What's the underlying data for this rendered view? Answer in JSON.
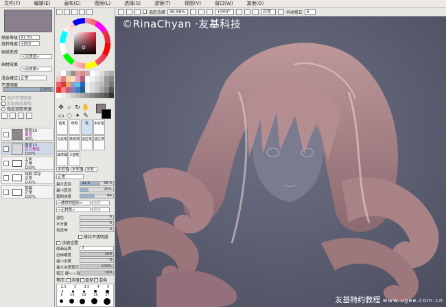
{
  "menu": [
    "文件(F)",
    "编辑(E)",
    "画布(C)",
    "图层(L)",
    "选择(S)",
    "滤镜(T)",
    "视图(V)",
    "窗口(W)",
    "其他(O)"
  ],
  "toolbar": {
    "selection_label": "选区边缘",
    "zoom": "90.96%",
    "angle": "+000°",
    "mode": "正常",
    "stabilizer_label": "抖动修正",
    "stabilizer_value": "6"
  },
  "left": {
    "zoom_label": "缩放等级",
    "zoom_value": "91.3%",
    "angle_label": "旋转角度",
    "angle_value": "+000",
    "paper_texture": "画纸质感",
    "paper_texture_value": "<无质感>",
    "paper_effect": "画材效果",
    "paper_effect_value": "<无效果>",
    "blend_mode_label": "混合模式",
    "blend_mode_value": "正常",
    "opacity_label": "不透明度",
    "opacity_value": "100%",
    "protect_opacity": "保护不透明度",
    "clip_group": "剪贴图层蒙版",
    "source_label": "指定选取来源",
    "layers": [
      {
        "name": "图层10",
        "mode": "覆盖",
        "opacity": "36%",
        "type": "layer",
        "color": "#8a8a8a"
      },
      {
        "name": "图层13",
        "mode": "正片叠底",
        "opacity": "100%",
        "type": "layer",
        "color": "#d8d8d8"
      },
      {
        "name": "上色",
        "mode": "正常",
        "opacity": "100%",
        "type": "folder"
      },
      {
        "name": "线稿 保存",
        "mode": "正常",
        "opacity": "100%",
        "type": "folder"
      },
      {
        "name": "草稿",
        "mode": "正常",
        "opacity": "100%",
        "type": "folder"
      }
    ]
  },
  "brushes": {
    "row1": [
      "铅笔",
      "喷枪",
      "笔",
      "水彩笔"
    ],
    "row2": [
      "马克笔",
      "橡皮擦",
      "选区笔",
      "选区擦"
    ],
    "row3": [
      "油漆桶",
      "2值笔"
    ],
    "row4": [
      "水彩笔",
      "水彩笔",
      "水彩"
    ]
  },
  "settings": {
    "mode": "正常",
    "max_diameter_label": "最大直径",
    "max_diameter_mult": "x1.0",
    "max_diameter_value": "38.0",
    "min_diameter_label": "最小直径",
    "min_diameter_value": "26%",
    "density_label": "笔刷浓度",
    "density_value": "44",
    "shape_value": "<通常的圆形>",
    "shape_strength": "强度",
    "texture_value": "<无材质>",
    "texture_strength": "强度",
    "blend_label": "混色",
    "blend_value": "0",
    "water_label": "水分量",
    "water_value": "0",
    "color_extend_label": "色延伸",
    "color_extend_value": "0",
    "keep_opacity": "维持不透明度",
    "detail_label": "详细设置",
    "quality_label": "绘画品质",
    "quality_value": "3",
    "edge_label": "边缘硬度",
    "edge_value": "100",
    "min_density_label": "最小浓度",
    "min_density_value": "0",
    "max_pressure_label": "最大浓度笔压",
    "max_pressure_value": "100%",
    "pressure_hard_label": "笔压 硬<->软",
    "pressure_hard_value": "100",
    "pressure_label": "笔压:",
    "pressure_density": "浓度",
    "pressure_diameter": "直径",
    "pressure_blend": "混色"
  },
  "dot_sizes": {
    "row1": [
      "2.3",
      "3",
      "3.5",
      "4",
      "5"
    ],
    "row2": [
      "5",
      "10",
      "13",
      "15",
      "17"
    ]
  },
  "watermark": "©RinaChyan ·友基科技",
  "footer": {
    "title": "友基特约教程",
    "url": "www.ugee.com.cn"
  },
  "colors": {
    "accent": "#5d5f72",
    "canvas_hair": "#b08a8e"
  }
}
